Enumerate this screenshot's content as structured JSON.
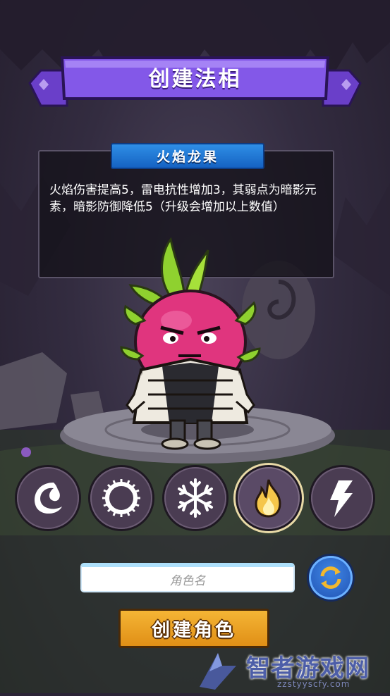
{
  "header": {
    "title": "创建法相"
  },
  "fruit": {
    "name": "火焰龙果",
    "description": "火焰伤害提高5，雷电抗性增加3，其弱点为暗影元素，暗影防御降低5（升级会增加以上数值）"
  },
  "elements": [
    {
      "name": "shadow",
      "icon": "crescent-swirl-icon",
      "selected": false
    },
    {
      "name": "light",
      "icon": "sun-ring-icon",
      "selected": false
    },
    {
      "name": "ice",
      "icon": "snowflake-icon",
      "selected": false
    },
    {
      "name": "fire",
      "icon": "flame-icon",
      "selected": true
    },
    {
      "name": "thunder",
      "icon": "lightning-icon",
      "selected": false
    }
  ],
  "name_input": {
    "placeholder": "角色名",
    "value": ""
  },
  "create_button": {
    "label": "创建角色"
  },
  "watermark": {
    "main": "智者游戏网",
    "sub": "zzstyyscfy.com"
  },
  "colors": {
    "banner": "#7a4fe0",
    "tab": "#1f72d6",
    "button": "#f2a325",
    "refresh": "#2c6cd4"
  }
}
